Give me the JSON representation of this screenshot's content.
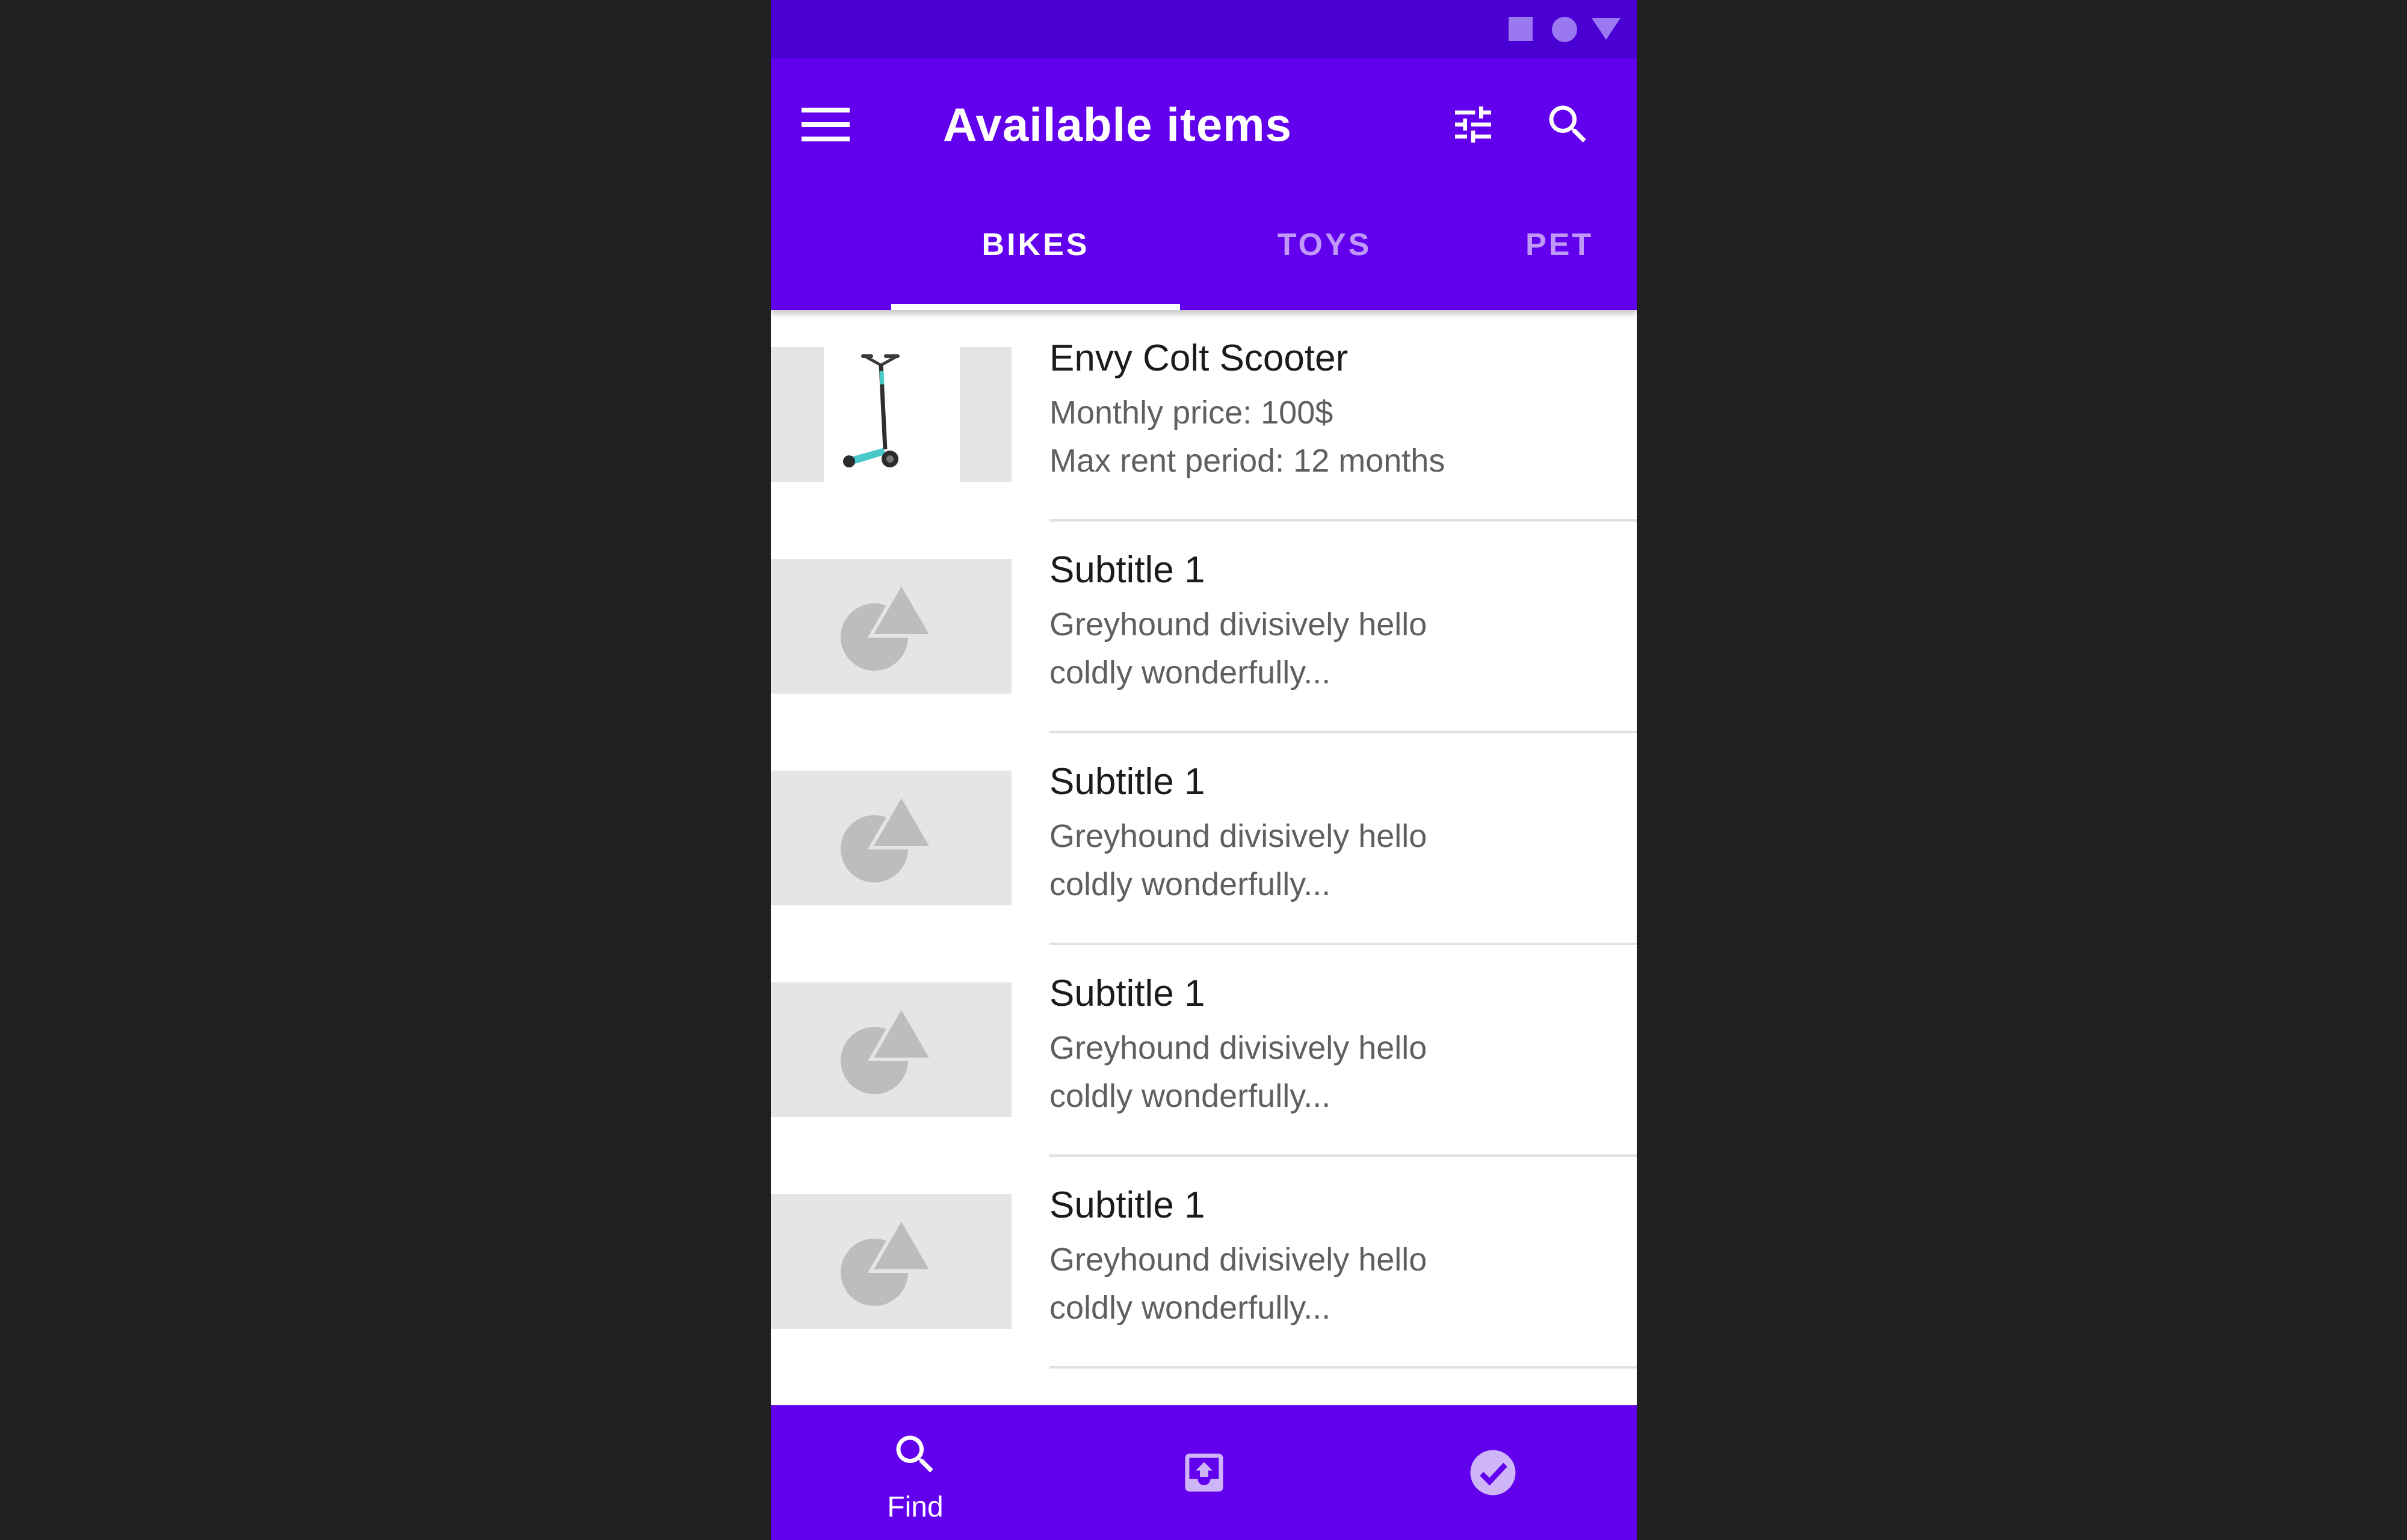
{
  "app_bar": {
    "title": "Available items",
    "menu_icon": "menu-icon",
    "filter_icon": "tune-icon",
    "search_icon": "search-icon",
    "background": "#6200ee"
  },
  "status_bar": {
    "background": "#4a00d3",
    "icons": [
      "square-icon",
      "circle-icon",
      "triangle-icon"
    ]
  },
  "tabs": [
    {
      "label": "BIKES",
      "active": true
    },
    {
      "label": "TOYS",
      "active": false
    },
    {
      "label": "PET",
      "active": false
    }
  ],
  "items": [
    {
      "title": "Envy Colt Scooter",
      "line1": "Monthly price: 100$",
      "line2": "Max rent period: 12 months",
      "image": "scooter-image"
    },
    {
      "title": "Subtitle 1",
      "line1": "Greyhound divisively hello",
      "line2": "coldly wonderfully...",
      "image": "placeholder-image"
    },
    {
      "title": "Subtitle 1",
      "line1": "Greyhound divisively hello",
      "line2": "coldly wonderfully...",
      "image": "placeholder-image"
    },
    {
      "title": "Subtitle 1",
      "line1": "Greyhound divisively hello",
      "line2": "coldly wonderfully...",
      "image": "placeholder-image"
    },
    {
      "title": "Subtitle 1",
      "line1": "Greyhound divisively hello",
      "line2": "coldly wonderfully...",
      "image": "placeholder-image"
    }
  ],
  "bottom_nav": [
    {
      "label": "Find",
      "icon": "search-icon",
      "active": true
    },
    {
      "label": "",
      "icon": "inbox-upload-icon",
      "active": false
    },
    {
      "label": "",
      "icon": "check-circle-icon",
      "active": false
    }
  ]
}
